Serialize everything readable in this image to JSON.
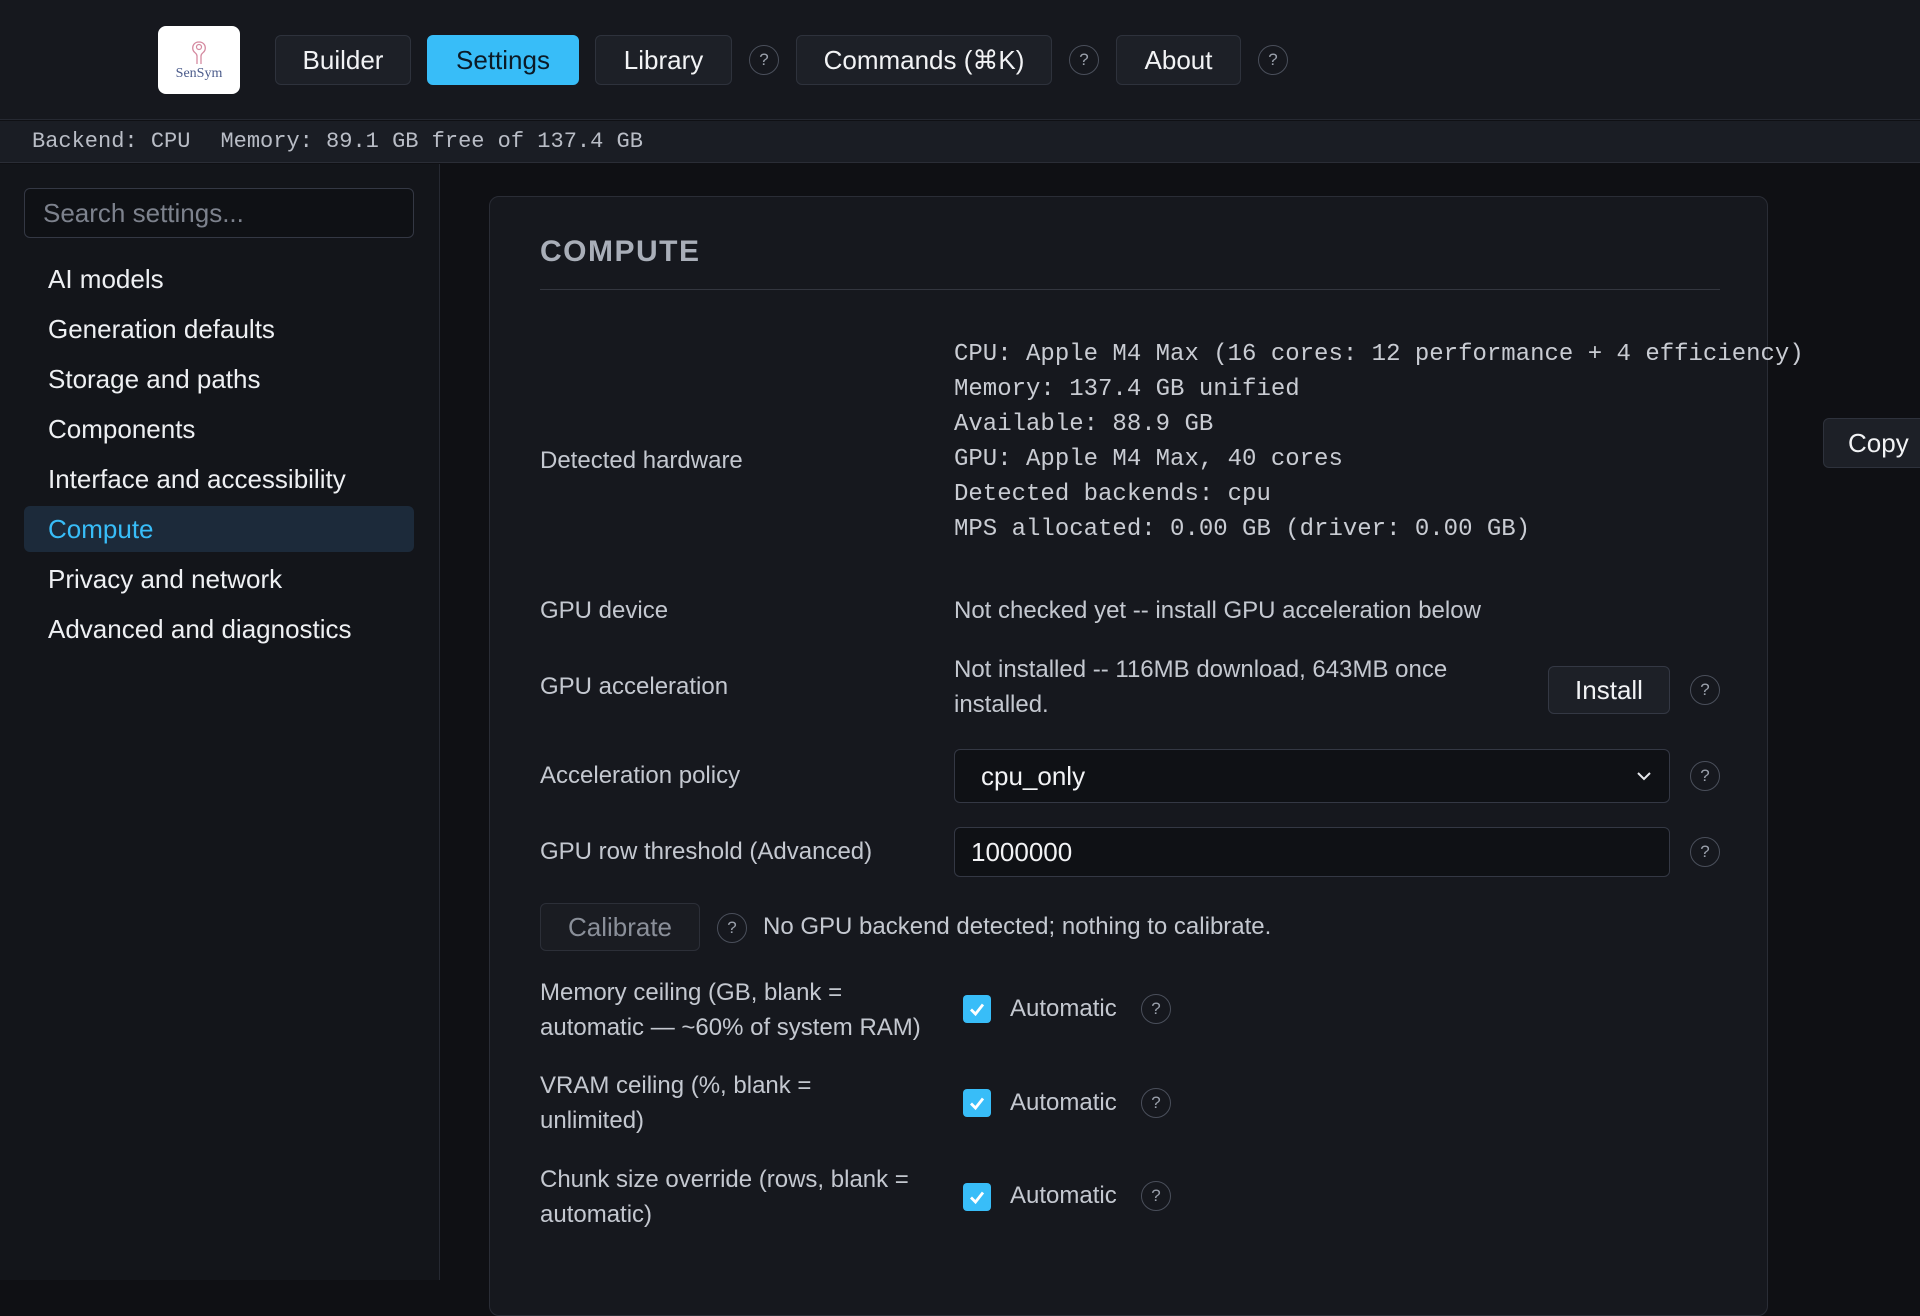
{
  "app": {
    "logo_text": "SenSym"
  },
  "nav": {
    "builder": "Builder",
    "settings": "Settings",
    "library": "Library",
    "commands": "Commands (⌘K)",
    "about": "About",
    "help_glyph": "?"
  },
  "status": {
    "backend": "Backend: CPU",
    "memory": "Memory: 89.1 GB free of 137.4 GB"
  },
  "sidebar": {
    "search_placeholder": "Search settings...",
    "items": [
      {
        "label": "AI models",
        "active": false
      },
      {
        "label": "Generation defaults",
        "active": false
      },
      {
        "label": "Storage and paths",
        "active": false
      },
      {
        "label": "Components",
        "active": false
      },
      {
        "label": "Interface and accessibility",
        "active": false
      },
      {
        "label": "Compute",
        "active": true
      },
      {
        "label": "Privacy and network",
        "active": false
      },
      {
        "label": "Advanced and diagnostics",
        "active": false
      }
    ]
  },
  "compute": {
    "title": "COMPUTE",
    "detected_hardware": {
      "label": "Detected hardware",
      "lines": [
        "CPU: Apple M4 Max (16 cores: 12 performance + 4 efficiency)",
        "Memory: 137.4 GB unified",
        "Available: 88.9 GB",
        "GPU: Apple M4 Max, 40 cores",
        "Detected backends: cpu",
        "MPS allocated: 0.00 GB (driver: 0.00 GB)"
      ],
      "copy_label": "Copy"
    },
    "gpu_device": {
      "label": "GPU device",
      "value": "Not checked yet -- install GPU acceleration below"
    },
    "gpu_acceleration": {
      "label": "GPU acceleration",
      "value_line1": "Not installed -- 116MB download, 643MB once",
      "value_line2": "installed.",
      "install_label": "Install"
    },
    "acceleration_policy": {
      "label": "Acceleration policy",
      "selected": "cpu_only"
    },
    "gpu_row_threshold": {
      "label": "GPU row threshold (Advanced)",
      "value": "1000000"
    },
    "calibrate": {
      "button_label": "Calibrate",
      "message": "No GPU backend detected; nothing to calibrate."
    },
    "memory_ceiling": {
      "label_line1": "Memory ceiling (GB, blank =",
      "label_line2": "automatic — ~60% of system RAM)",
      "checkbox_label": "Automatic",
      "checked": true
    },
    "vram_ceiling": {
      "label_line1": "VRAM ceiling (%, blank =",
      "label_line2": "unlimited)",
      "checkbox_label": "Automatic",
      "checked": true
    },
    "chunk_size": {
      "label_line1": "Chunk size override (rows, blank =",
      "label_line2": "automatic)",
      "checkbox_label": "Automatic",
      "checked": true
    }
  },
  "colors": {
    "accent": "#38bdf8",
    "background": "#0f1014",
    "panel": "#16181e"
  }
}
